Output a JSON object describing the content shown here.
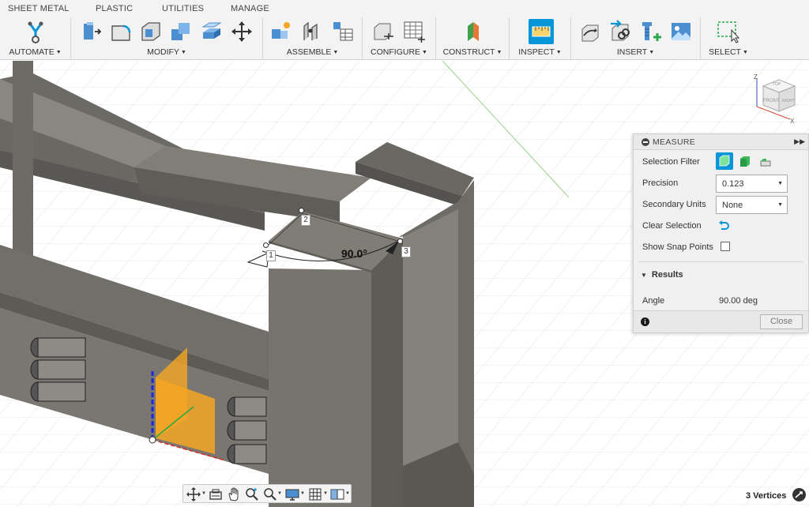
{
  "tabs": [
    "SHEET METAL",
    "PLASTIC",
    "UTILITIES",
    "MANAGE"
  ],
  "toolbar": {
    "groups": [
      {
        "label": "AUTOMATE",
        "icons": [
          "automate-icon"
        ]
      },
      {
        "label": "MODIFY",
        "icons": [
          "press-pull-icon",
          "fillet-icon",
          "shell-icon",
          "combine-icon",
          "offset-face-icon",
          "move-icon"
        ]
      },
      {
        "label": "ASSEMBLE",
        "icons": [
          "new-component-icon",
          "joint-icon",
          "table-icon"
        ]
      },
      {
        "label": "CONFIGURE",
        "icons": [
          "configure-icon",
          "configure-table-icon"
        ]
      },
      {
        "label": "CONSTRUCT",
        "icons": [
          "construct-plane-icon"
        ]
      },
      {
        "label": "INSPECT",
        "icons": [
          "measure-icon"
        ]
      },
      {
        "label": "INSERT",
        "icons": [
          "insert-derive-icon",
          "insert-link-icon",
          "insert-mcmaster-icon",
          "insert-canvas-icon"
        ]
      },
      {
        "label": "SELECT",
        "icons": [
          "select-window-icon"
        ]
      }
    ]
  },
  "viewport": {
    "angle_label": "90.0°",
    "points": [
      "1",
      "2",
      "3"
    ],
    "viewcube": {
      "top": "TOP",
      "front": "FRONT",
      "right": "RIGHT",
      "z_axis": "Z",
      "x_axis": "X"
    }
  },
  "measure": {
    "title": "MEASURE",
    "selection_filter_label": "Selection Filter",
    "precision_label": "Precision",
    "precision_value": "0.123",
    "secondary_units_label": "Secondary Units",
    "secondary_units_value": "None",
    "clear_selection_label": "Clear Selection",
    "show_snap_points_label": "Show Snap Points",
    "results_label": "Results",
    "angle_label": "Angle",
    "angle_value": "90.00 deg",
    "close_label": "Close",
    "info_glyph": "i"
  },
  "status": {
    "text": "3 Vertices"
  },
  "colors": {
    "accent": "#0696d7",
    "model": "#76736e",
    "orange": "#f5a623"
  }
}
